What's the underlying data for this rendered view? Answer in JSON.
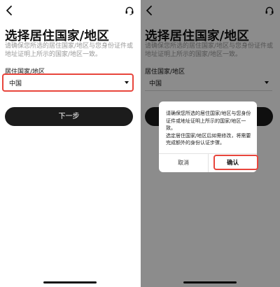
{
  "left": {
    "title": "选择居住国家/地区",
    "subtitle": "请确保您所选的居住国家/地区与您身份证件或地址证明上所示的国家/地区一致。",
    "field_label": "居住国家/地区",
    "selected_country": "中国",
    "next_button": "下一步"
  },
  "right": {
    "title": "选择居住国家/地区",
    "subtitle": "请确保您所选的居住国家/地区与您身份证件或地址证明上所示的国家/地区一致。",
    "field_label": "居住国家/地区",
    "selected_country": "中国",
    "dialog": {
      "message_line1": "请确保您所选的居住国家/地区与您身份证件或地址证明上所示的国家/地区一致。",
      "message_line2": "选定居住国家/地区后如需修改，将需要完成额外的身份认证步骤。",
      "cancel": "取消",
      "confirm": "确认"
    }
  },
  "colors": {
    "accent_highlight": "#e8453c",
    "primary_button": "#1c1c1c",
    "overlay": "rgba(0,0,0,0.45)"
  },
  "icons": {
    "back": "chevron-left-icon",
    "support": "headset-icon",
    "dropdown": "caret-down-icon"
  }
}
